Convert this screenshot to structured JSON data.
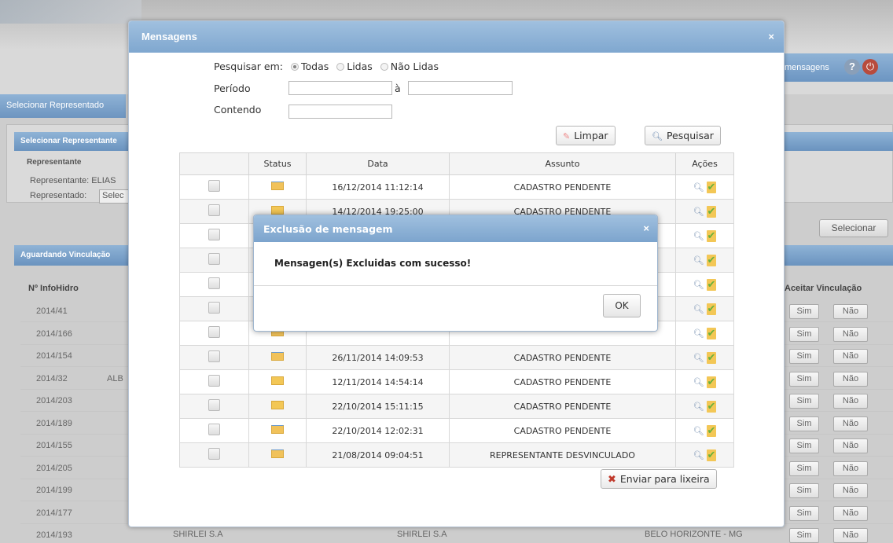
{
  "background": {
    "tab_label": "Selecionar Representado",
    "panel_title": "Selecionar Representante",
    "label_representante": "Representante",
    "label_representante_value": "Representante:  ELIAS",
    "label_representado": "Representado:",
    "select_value": "Selec",
    "section_title": "Aguardando Vinculação",
    "selecionar_button": "Selecionar",
    "col_numero": "Nº InfoHidro",
    "col_aceitar": "Aceitar Vinculação",
    "messages_link": "mensagens",
    "help_icon": "?",
    "rows": [
      {
        "num": "2014/41",
        "extra": ""
      },
      {
        "num": "2014/166",
        "extra": ""
      },
      {
        "num": "2014/154",
        "extra": ""
      },
      {
        "num": "2014/32",
        "extra": "ALB"
      },
      {
        "num": "2014/203",
        "extra": ""
      },
      {
        "num": "2014/189",
        "extra": ""
      },
      {
        "num": "2014/155",
        "extra": ""
      },
      {
        "num": "2014/205",
        "extra": ""
      },
      {
        "num": "2014/199",
        "extra": ""
      },
      {
        "num": "2014/177",
        "extra": ""
      },
      {
        "num": "2014/193",
        "extra": ""
      }
    ],
    "sim_label": "Sim",
    "nao_label": "Não",
    "last_row": {
      "col1": "SHIRLEI S.A",
      "col2": "SHIRLEI S.A",
      "col3": "BELO HORIZONTE - MG"
    }
  },
  "dialog": {
    "title": "Mensagens",
    "close": "×",
    "search_label": "Pesquisar em:",
    "radio_all": "Todas",
    "radio_read": "Lidas",
    "radio_unread": "Não Lidas",
    "period_label": "Período",
    "period_to": "à",
    "contains_label": "Contendo",
    "clear_button": "Limpar",
    "search_button": "Pesquisar",
    "send_trash_button": "Enviar para lixeira",
    "columns": [
      "",
      "Status",
      "Data",
      "Assunto",
      "Ações"
    ],
    "rows": [
      {
        "status": "open",
        "date": "16/12/2014 11:12:14",
        "subject": "CADASTRO PENDENTE"
      },
      {
        "status": "new",
        "date": "14/12/2014 19:25:00",
        "subject": "CADASTRO PENDENTE"
      },
      {
        "status": "new",
        "date": "",
        "subject": ""
      },
      {
        "status": "new",
        "date": "",
        "subject": ""
      },
      {
        "status": "new",
        "date": "",
        "subject": ""
      },
      {
        "status": "new",
        "date": "",
        "subject": ""
      },
      {
        "status": "open",
        "date": "",
        "subject": ""
      },
      {
        "status": "open",
        "date": "26/11/2014 14:09:53",
        "subject": "CADASTRO PENDENTE"
      },
      {
        "status": "new",
        "date": "12/11/2014 14:54:14",
        "subject": "CADASTRO PENDENTE"
      },
      {
        "status": "new",
        "date": "22/10/2014 15:11:15",
        "subject": "CADASTRO PENDENTE"
      },
      {
        "status": "open",
        "date": "22/10/2014 12:02:31",
        "subject": "CADASTRO PENDENTE"
      },
      {
        "status": "open",
        "date": "21/08/2014 09:04:51",
        "subject": "REPRESENTANTE DESVINCULADO"
      }
    ]
  },
  "alert": {
    "title": "Exclusão de mensagem",
    "close": "×",
    "message": "Mensagen(s) Excluidas com sucesso!",
    "ok_button": "OK"
  },
  "colors": {
    "header_blue": "#7fa7cf",
    "envelope_yellow": "#f3c756",
    "check_green": "#69b13d"
  }
}
